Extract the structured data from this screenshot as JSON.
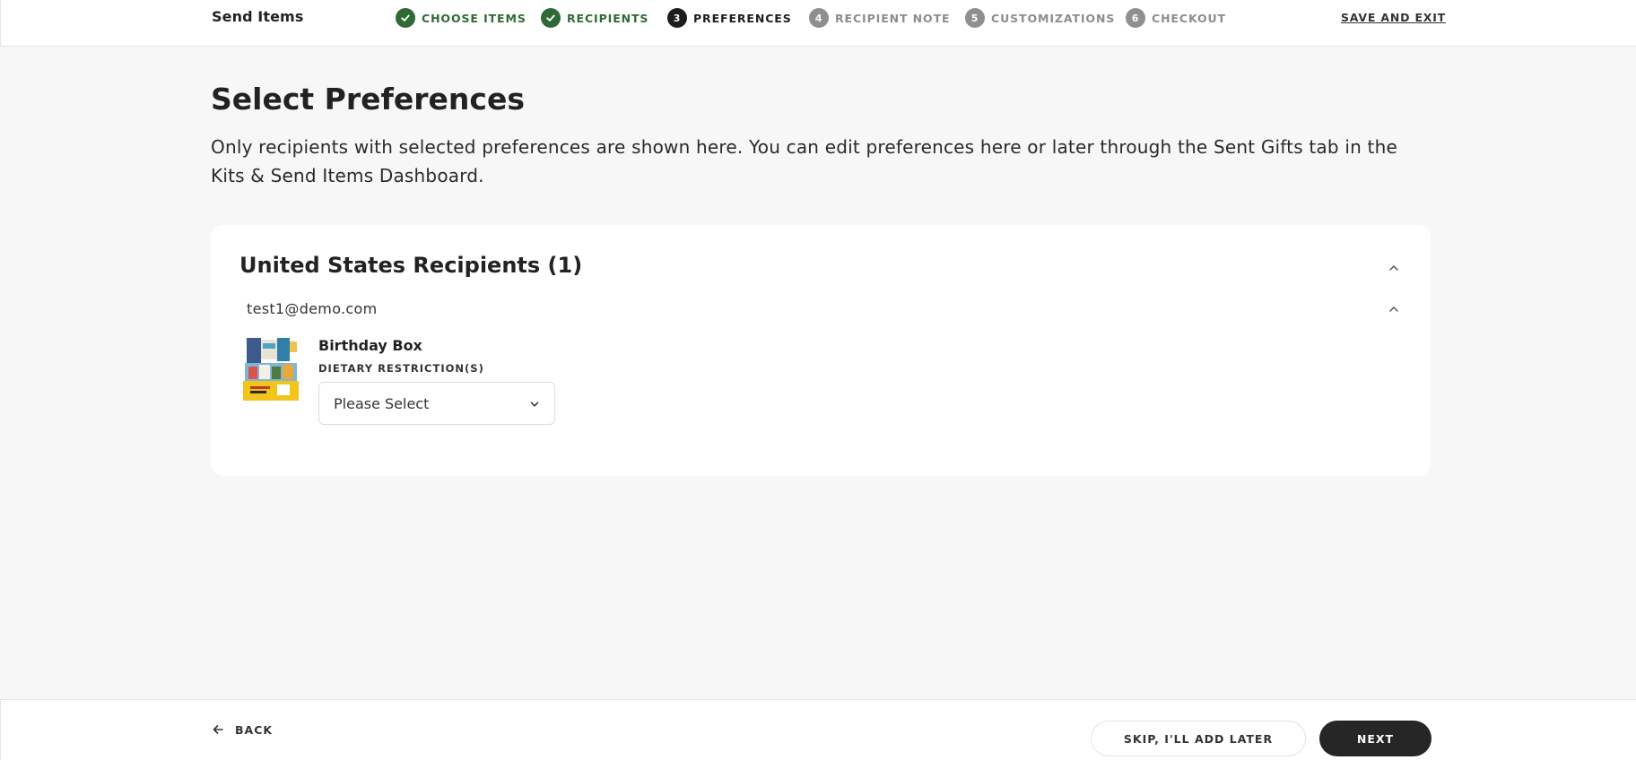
{
  "header": {
    "title": "Send Items",
    "steps": [
      {
        "number": "1",
        "label": "CHOOSE ITEMS",
        "state": "done"
      },
      {
        "number": "2",
        "label": "RECIPIENTS",
        "state": "done"
      },
      {
        "number": "3",
        "label": "PREFERENCES",
        "state": "active"
      },
      {
        "number": "4",
        "label": "RECIPIENT NOTE",
        "state": "todo"
      },
      {
        "number": "5",
        "label": "CUSTOMIZATIONS",
        "state": "todo"
      },
      {
        "number": "6",
        "label": "CHECKOUT",
        "state": "todo"
      }
    ],
    "save_exit_label": "SAVE AND EXIT"
  },
  "main": {
    "title": "Select Preferences",
    "description": "Only recipients with selected preferences are shown here. You can edit preferences here or later through the Sent Gifts tab in the Kits & Send Items Dashboard.",
    "group": {
      "title": "United States Recipients (1)",
      "recipient_email": "test1@demo.com",
      "item": {
        "name": "Birthday Box",
        "field_label": "DIETARY RESTRICTION(S)",
        "select_value": "Please Select"
      }
    }
  },
  "footer": {
    "back_label": "BACK",
    "skip_label": "SKIP, I'LL ADD LATER",
    "next_label": "NEXT"
  },
  "colors": {
    "done": "#2d6a35",
    "active": "#1d1d1f",
    "todo": "#8f8f8f",
    "primary_button": "#262626",
    "background": "#f7f7f7"
  }
}
